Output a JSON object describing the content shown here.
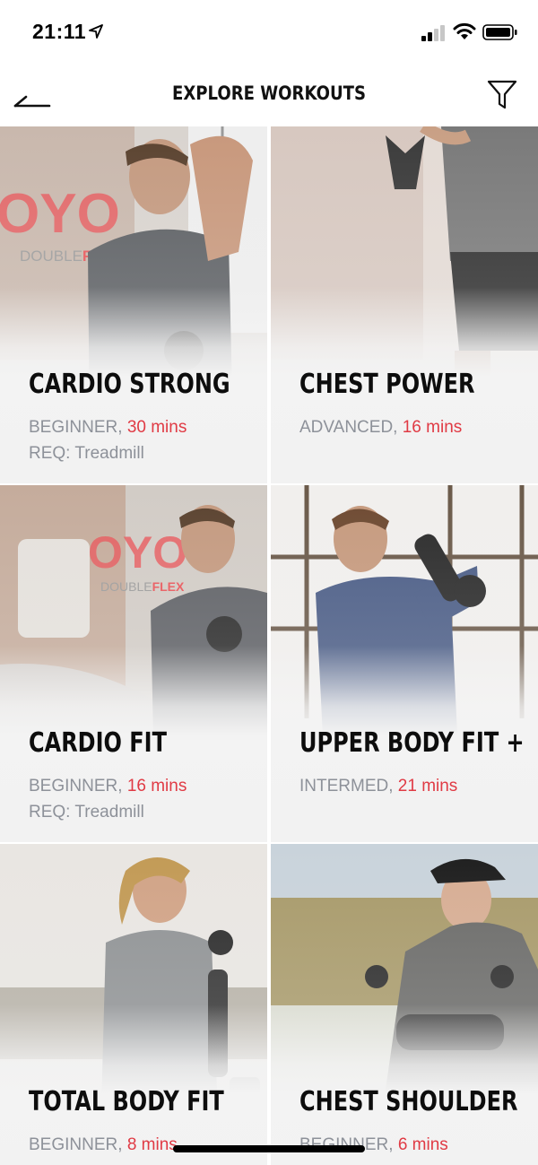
{
  "status_bar": {
    "time": "21:11"
  },
  "nav": {
    "title": "EXPLORE WORKOUTS"
  },
  "workouts": [
    {
      "title": "CARDIO STRONG",
      "level": "BEGINNER,",
      "duration": "30 mins",
      "req": "REQ: Treadmill"
    },
    {
      "title": "CHEST POWER",
      "level": "ADVANCED,",
      "duration": "16 mins",
      "req": ""
    },
    {
      "title": "CARDIO FIT",
      "level": "BEGINNER,",
      "duration": "16 mins",
      "req": "REQ: Treadmill"
    },
    {
      "title": "UPPER BODY FIT +",
      "level": "INTERMED,",
      "duration": "21 mins",
      "req": ""
    },
    {
      "title": "TOTAL BODY FIT",
      "level": "BEGINNER,",
      "duration": "8 mins",
      "req": ""
    },
    {
      "title": "CHEST SHOULDER",
      "level": "BEGINNER,",
      "duration": "6 mins",
      "req": ""
    }
  ],
  "colors": {
    "accent": "#e03a44",
    "meta_gray": "#8d9199",
    "title": "#0d0d0d"
  },
  "icons": {
    "back": "back-arrow-icon",
    "filter": "filter-funnel-icon",
    "location": "location-arrow-icon",
    "signal": "cellular-signal-icon",
    "wifi": "wifi-icon",
    "battery": "battery-icon"
  }
}
